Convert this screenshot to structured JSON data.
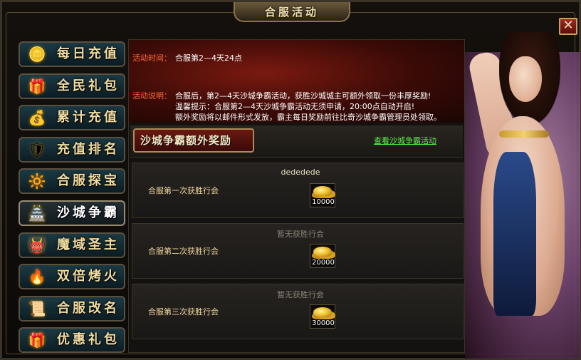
{
  "window": {
    "title": "合服活动",
    "close_label": "✕"
  },
  "sidebar": {
    "items": [
      {
        "label": "每日充值",
        "icon": "treasure-icon"
      },
      {
        "label": "全民礼包",
        "icon": "gift-icon"
      },
      {
        "label": "累计充值",
        "icon": "coin-bag-icon"
      },
      {
        "label": "充值排名",
        "icon": "armor-icon"
      },
      {
        "label": "合服探宝",
        "icon": "gold-orb-icon"
      },
      {
        "label": "沙城争霸",
        "icon": "castle-icon",
        "active": true
      },
      {
        "label": "魔域圣主",
        "icon": "demon-mask-icon"
      },
      {
        "label": "双倍烤火",
        "icon": "campfire-icon"
      },
      {
        "label": "合服改名",
        "icon": "scroll-icon"
      },
      {
        "label": "优惠礼包",
        "icon": "gift-box-icon"
      }
    ]
  },
  "activity": {
    "time_label": "活动时间：",
    "time_value": "合服第2—4天24点",
    "desc_label": "活动说明：",
    "desc_line1": "合服后，第2—4天沙城争霸活动，获胜沙城城主可额外领取一份丰厚奖励!",
    "desc_line2": "温馨提示：合服第2—4天沙城争霸活动无须申请，20:00点自动开启!",
    "desc_line3": "额外奖励将以邮件形式发放，霸主每日奖励前往比奇沙城争霸管理员处领取。"
  },
  "section": {
    "title": "沙城争霸额外奖励",
    "link": "查看沙城争霸活动"
  },
  "rewards": [
    {
      "label": "合服第一次获胜行会",
      "guild": "dededede",
      "amount": "10000"
    },
    {
      "label": "合服第二次获胜行会",
      "guild": "暂无获胜行会",
      "amount": "20000"
    },
    {
      "label": "合服第三次获胜行会",
      "guild": "暂无获胜行会",
      "amount": "30000"
    }
  ],
  "colors": {
    "accent_gold": "#f0dba0",
    "link_green": "#5af04a",
    "label_red": "#ff6a3a"
  }
}
